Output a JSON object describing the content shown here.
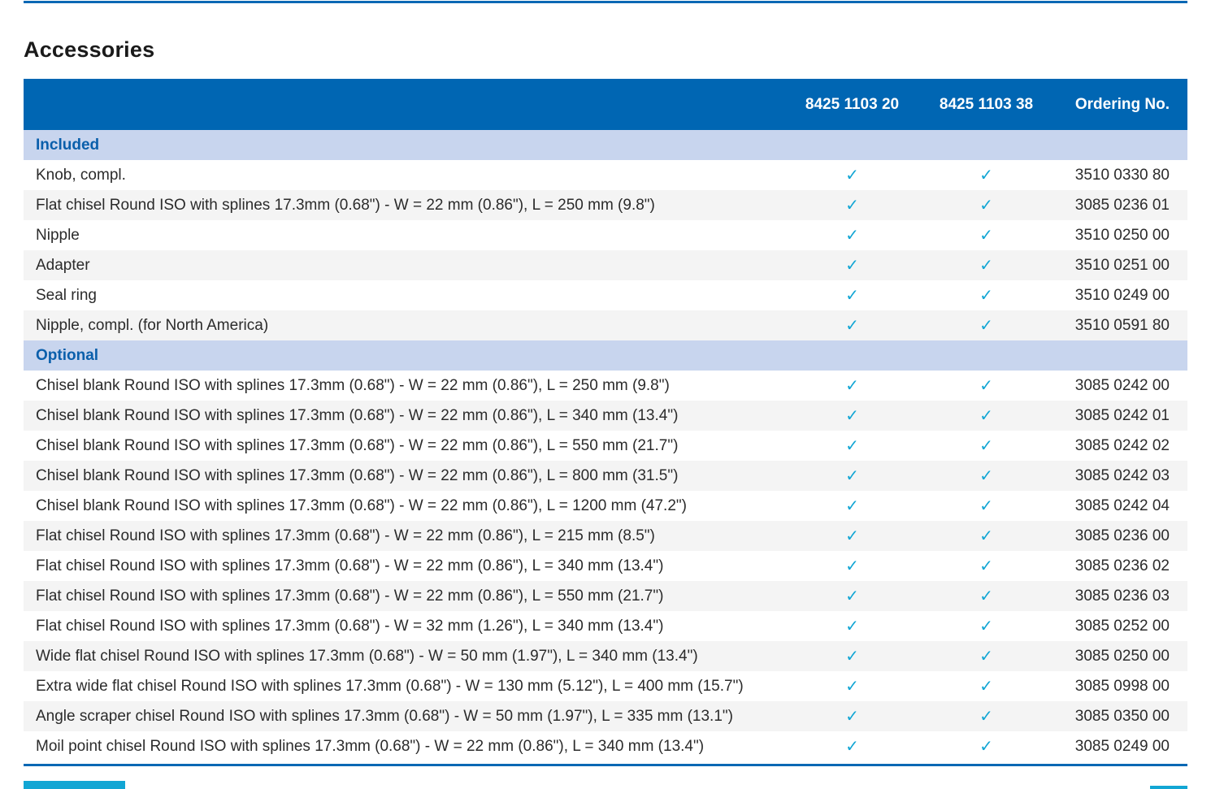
{
  "title": "Accessories",
  "colors": {
    "header_bg": "#0066b3",
    "section_bg": "#c8d5ee",
    "section_text": "#0a5fab",
    "check": "#12a6d4",
    "rule": "#0a68b4"
  },
  "columns": {
    "description": "",
    "model_a": "8425 1103 20",
    "model_b": "8425 1103 38",
    "ordering_no": "Ordering No."
  },
  "check_icon": "checkmark-icon",
  "sections": [
    {
      "name": "Included",
      "rows": [
        {
          "description": "Knob, compl.",
          "model_a": "✓",
          "model_b": "✓",
          "ordering_no": "3510 0330 80"
        },
        {
          "description": "Flat chisel Round ISO with splines 17.3mm (0.68\") - W = 22 mm (0.86\"), L = 250 mm (9.8\")",
          "model_a": "✓",
          "model_b": "✓",
          "ordering_no": "3085 0236 01"
        },
        {
          "description": "Nipple",
          "model_a": "✓",
          "model_b": "✓",
          "ordering_no": "3510 0250 00"
        },
        {
          "description": "Adapter",
          "model_a": "✓",
          "model_b": "✓",
          "ordering_no": "3510 0251 00"
        },
        {
          "description": "Seal ring",
          "model_a": "✓",
          "model_b": "✓",
          "ordering_no": "3510 0249 00"
        },
        {
          "description": "Nipple, compl. (for North America)",
          "model_a": "✓",
          "model_b": "✓",
          "ordering_no": "3510 0591 80"
        }
      ]
    },
    {
      "name": "Optional",
      "rows": [
        {
          "description": "Chisel blank Round ISO with splines 17.3mm (0.68\") - W = 22 mm (0.86\"), L = 250 mm (9.8\")",
          "model_a": "✓",
          "model_b": "✓",
          "ordering_no": "3085 0242 00"
        },
        {
          "description": "Chisel blank Round ISO with splines 17.3mm (0.68\") - W = 22 mm (0.86\"), L = 340 mm (13.4\")",
          "model_a": "✓",
          "model_b": "✓",
          "ordering_no": "3085 0242 01"
        },
        {
          "description": "Chisel blank Round ISO with splines 17.3mm (0.68\") - W = 22 mm (0.86\"), L = 550 mm (21.7\")",
          "model_a": "✓",
          "model_b": "✓",
          "ordering_no": "3085 0242 02"
        },
        {
          "description": "Chisel blank Round ISO with splines 17.3mm (0.68\") - W = 22 mm (0.86\"), L = 800 mm (31.5\")",
          "model_a": "✓",
          "model_b": "✓",
          "ordering_no": "3085 0242 03"
        },
        {
          "description": "Chisel blank Round ISO with splines 17.3mm (0.68\") - W = 22 mm (0.86\"), L = 1200 mm (47.2\")",
          "model_a": "✓",
          "model_b": "✓",
          "ordering_no": "3085 0242 04"
        },
        {
          "description": "Flat chisel Round ISO with splines 17.3mm (0.68\") - W = 22 mm (0.86\"), L = 215 mm (8.5\")",
          "model_a": "✓",
          "model_b": "✓",
          "ordering_no": "3085 0236 00"
        },
        {
          "description": "Flat chisel Round ISO with splines 17.3mm (0.68\") - W = 22 mm (0.86\"), L = 340 mm (13.4\")",
          "model_a": "✓",
          "model_b": "✓",
          "ordering_no": "3085 0236 02"
        },
        {
          "description": "Flat chisel Round ISO with splines 17.3mm (0.68\") - W = 22 mm (0.86\"), L = 550 mm (21.7\")",
          "model_a": "✓",
          "model_b": "✓",
          "ordering_no": "3085 0236 03"
        },
        {
          "description": "Flat chisel Round ISO with splines 17.3mm (0.68\") - W = 32 mm (1.26\"), L = 340 mm (13.4\")",
          "model_a": "✓",
          "model_b": "✓",
          "ordering_no": "3085 0252 00"
        },
        {
          "description": "Wide flat chisel Round ISO with splines 17.3mm (0.68\") - W = 50 mm (1.97\"), L = 340 mm (13.4\")",
          "model_a": "✓",
          "model_b": "✓",
          "ordering_no": "3085 0250 00"
        },
        {
          "description": "Extra wide flat chisel Round ISO with splines 17.3mm (0.68\") - W = 130 mm (5.12\"), L = 400 mm (15.7\")",
          "model_a": "✓",
          "model_b": "✓",
          "ordering_no": "3085 0998 00"
        },
        {
          "description": "Angle scraper chisel Round ISO with splines 17.3mm (0.68\") - W = 50 mm (1.97\"), L = 335 mm (13.1\")",
          "model_a": "✓",
          "model_b": "✓",
          "ordering_no": "3085 0350 00"
        },
        {
          "description": "Moil point chisel Round ISO with splines 17.3mm (0.68\") - W = 22 mm (0.86\"), L = 340 mm (13.4\")",
          "model_a": "✓",
          "model_b": "✓",
          "ordering_no": "3085 0249 00"
        }
      ]
    }
  ]
}
